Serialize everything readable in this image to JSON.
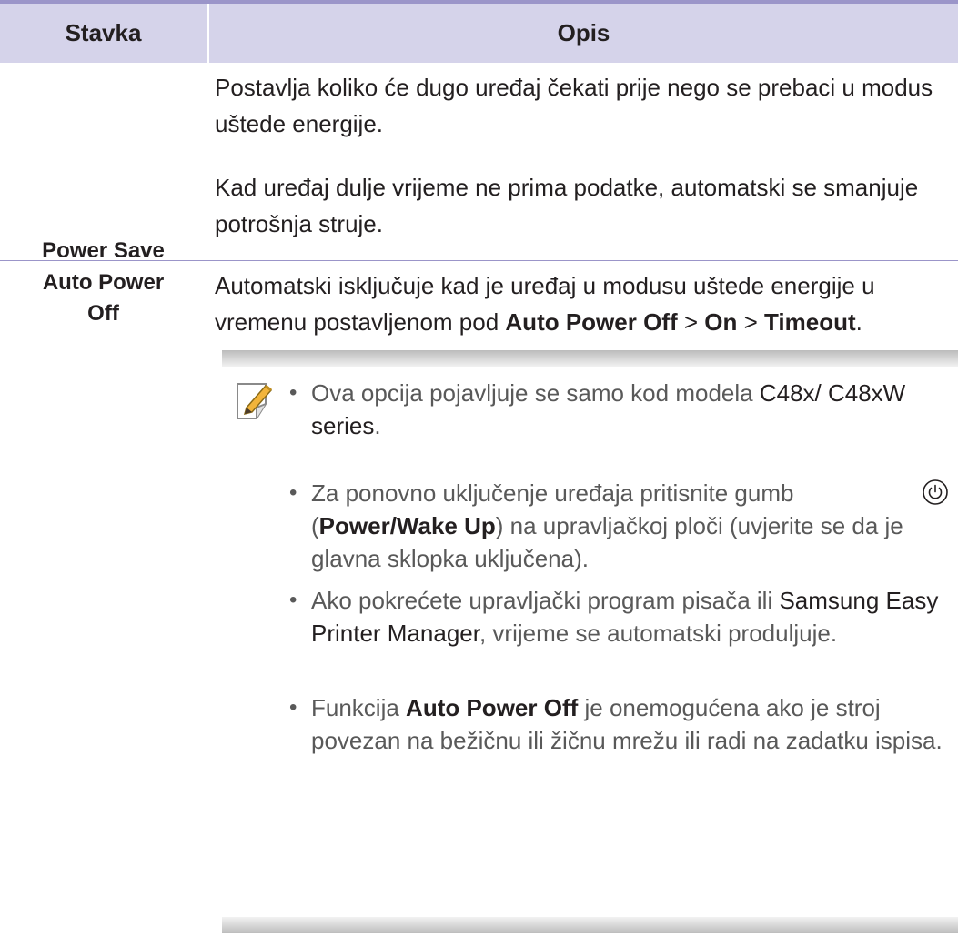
{
  "table": {
    "headers": {
      "item": "Stavka",
      "description": "Opis"
    },
    "rows": [
      {
        "item": "Power Save",
        "paragraphs": [
          "Postavlja koliko će dugo uređaj čekati prije nego se prebaci u modus uštede energije.",
          "Kad uređaj dulje vrijeme ne prima podatke, automatski se smanjuje potrošnja struje."
        ]
      },
      {
        "item_line1": "Auto Power",
        "item_line2": "Off",
        "intro": {
          "text_a": "Automatski isključuje kad je uređaj u modusu uštede energije u vremenu postavljenom pod ",
          "bold_1": "Auto Power Off",
          "sep_1": " > ",
          "bold_2": "On",
          "sep_2": " > ",
          "bold_3": "Timeout",
          "end": "."
        },
        "note": {
          "icon": "note-pencil-icon",
          "bullets": [
            {
              "text_a": "Ova opcija pojavljuje se samo kod modela ",
              "model": "C48x/ C48xW series",
              "end": "."
            },
            {
              "text_a": "Za ponovno uključenje uređaja pritisnite gumb ",
              "button_icon": "power-icon",
              "paren_open": "(",
              "bold": "Power/Wake Up",
              "text_b": ") na upravljačkoj ploči (uvjerite se da je glavna sklopka uključena)."
            },
            {
              "text_a": "Ako pokrećete upravljački program pisača ili ",
              "app": "Samsung Easy Printer Manager",
              "text_b": ", vrijeme se automatski produljuje."
            },
            {
              "text_a": "Funkcija ",
              "bold": "Auto Power Off",
              "text_b": " je onemogućena ako je stroj povezan na bežičnu ili žičnu mrežu ili radi na zadatku ispisa."
            }
          ],
          "bullet_char": "•"
        }
      }
    ]
  },
  "colors": {
    "header_bg": "#d5d3ea",
    "rule": "#9b95c9",
    "text": "#231f20",
    "note_text": "#595959"
  }
}
